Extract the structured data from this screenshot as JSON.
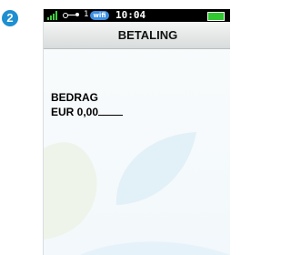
{
  "step": {
    "number": "2"
  },
  "status_bar": {
    "signal_icon": "signal-strength-icon",
    "connection_icon": "connection-icon",
    "connection_count": "1",
    "wifi_label": "wifi",
    "time": "10:04",
    "battery_icon": "battery-icon"
  },
  "header": {
    "title": "BETALING"
  },
  "payment": {
    "amount_label": "BEDRAG",
    "amount_value": "EUR 0,00"
  },
  "colors": {
    "step_badge": "#1e8fd0",
    "signal": "#3fd13f",
    "battery": "#31c831",
    "wifi_badge": "#3c8ee0"
  }
}
